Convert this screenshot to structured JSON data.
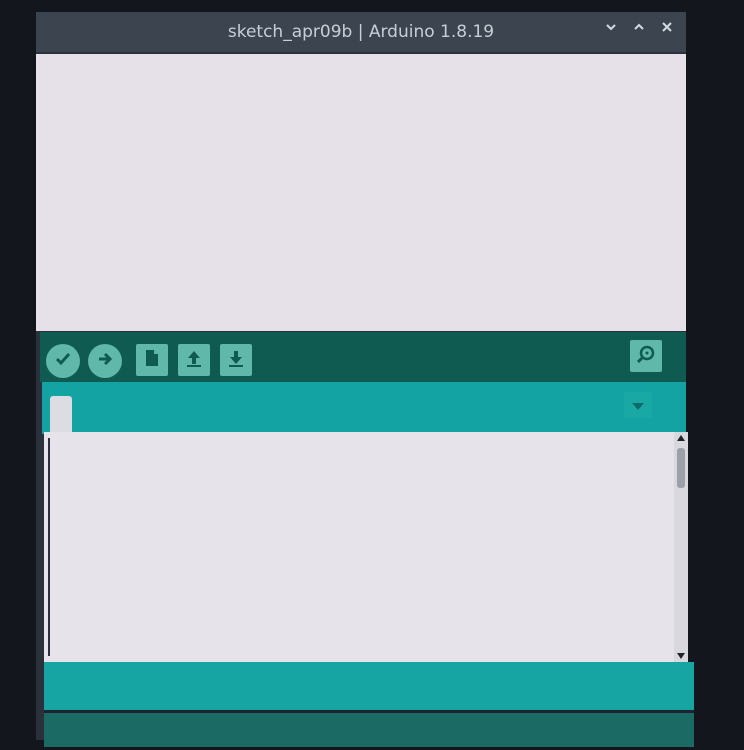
{
  "window": {
    "title": "sketch_apr09b | Arduino 1.8.19"
  },
  "window_controls": [
    {
      "icon": "minimize-icon"
    },
    {
      "icon": "maximize-icon"
    },
    {
      "icon": "close-icon"
    }
  ],
  "toolbar": {
    "buttons": [
      {
        "icon": "verify-checkmark-icon"
      },
      {
        "icon": "upload-arrow-icon"
      },
      {
        "icon": "new-file-icon"
      },
      {
        "icon": "open-arrow-up-icon"
      },
      {
        "icon": "save-arrow-down-icon"
      }
    ],
    "serial_monitor_icon": "magnifier-icon"
  },
  "tabs": {
    "menu_icon": "dropdown-triangle-icon"
  },
  "colors": {
    "toolbar": "#0f5b52",
    "tabbar": "#14a3a3",
    "button": "#5fb8aa",
    "editor_bg": "#e7e3ea",
    "status": "#17a5a3",
    "console": "#1b6a63"
  }
}
